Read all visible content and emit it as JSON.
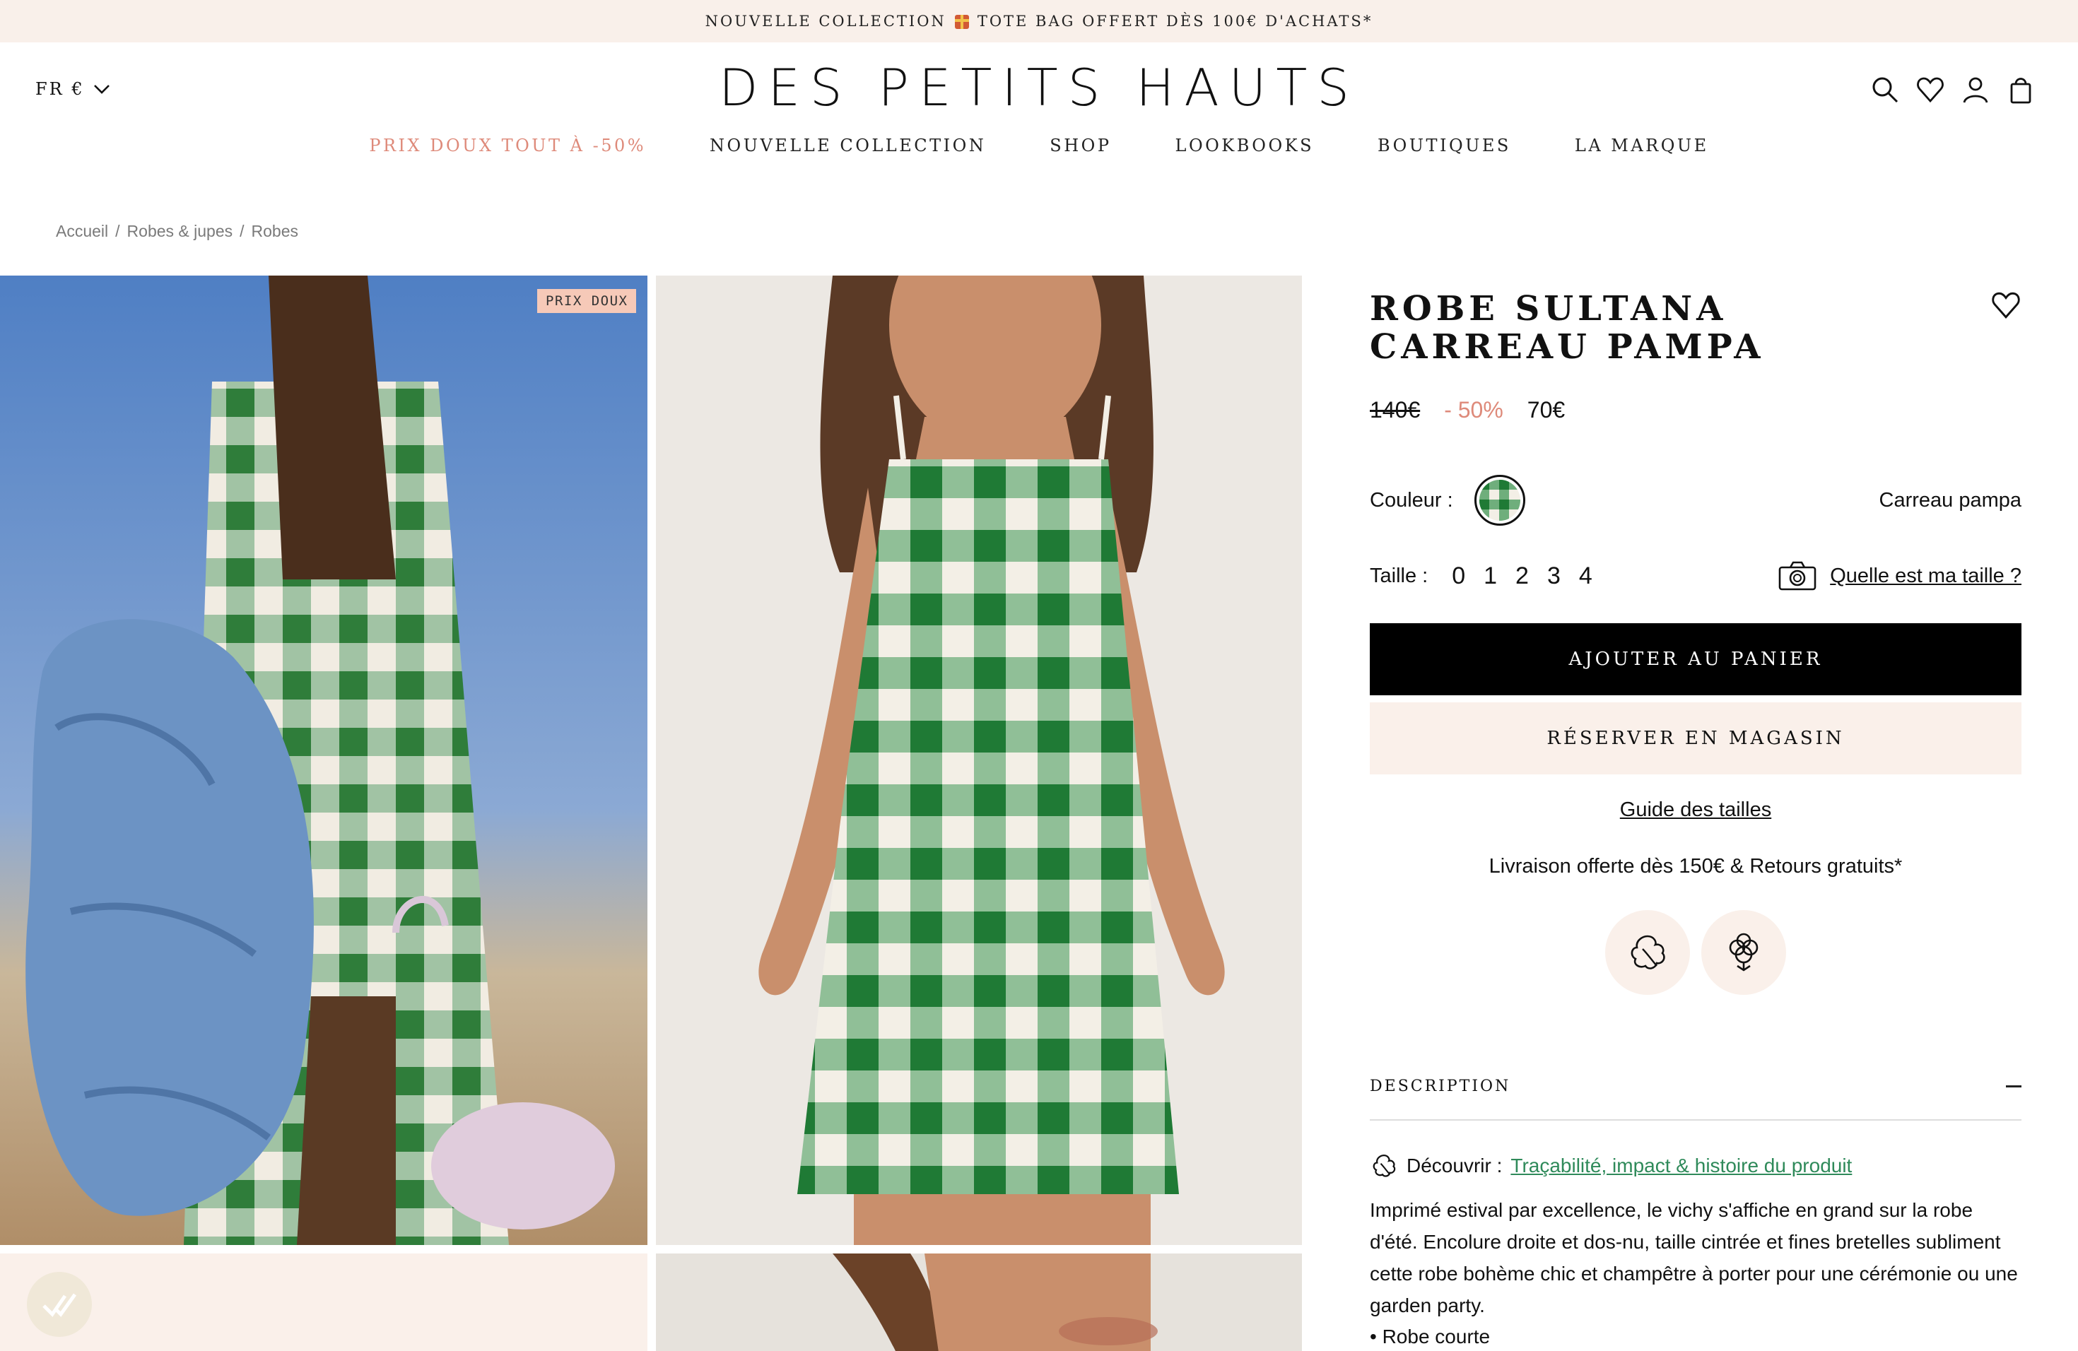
{
  "announcement": {
    "left": "NOUVELLE COLLECTION",
    "right": "TOTE BAG OFFERT DÈS 100€ D'ACHATS*"
  },
  "header": {
    "locale": "FR €",
    "logo": "DES PETITS HAUTS",
    "icons": [
      "search-icon",
      "heart-icon",
      "account-icon",
      "bag-icon"
    ]
  },
  "nav": {
    "items": [
      {
        "label": "PRIX DOUX TOUT À -50%",
        "color": "#de8a7a"
      },
      {
        "label": "NOUVELLE COLLECTION"
      },
      {
        "label": "SHOP"
      },
      {
        "label": "LOOKBOOKS"
      },
      {
        "label": "BOUTIQUES"
      },
      {
        "label": "LA MARQUE"
      }
    ]
  },
  "breadcrumb": [
    "Accueil",
    "Robes & jupes",
    "Robes"
  ],
  "gallery": {
    "badge": "PRIX DOUX"
  },
  "product": {
    "title": "ROBE SULTANA CARREAU PAMPA",
    "old_price": "140€",
    "discount": "- 50%",
    "price": "70€",
    "color_label": "Couleur :",
    "color_name": "Carreau pampa",
    "size_label": "Taille :",
    "sizes": [
      "0",
      "1",
      "2",
      "3",
      "4"
    ],
    "size_help": "Quelle est ma taille ?",
    "add_to_cart": "AJOUTER AU PANIER",
    "reserve": "RÉSERVER EN MAGASIN",
    "size_guide": "Guide des tailles",
    "shipping": "Livraison offerte dès 150€ & Retours gratuits*",
    "eco_icons": [
      "leaf-icon",
      "cotton-icon"
    ],
    "description_title": "DESCRIPTION",
    "discover_label": "Découvrir :",
    "discover_link": "Traçabilité, impact & histoire du produit",
    "description": "Imprimé estival par excellence, le vichy s'affiche en grand sur la robe d'été. Encolure droite et dos-nu, taille cintrée et fines bretelles subliment cette robe bohème chic et champêtre à porter pour une cérémonie ou une garden party.",
    "bullet": "• Robe courte"
  },
  "colors": {
    "accent": "#de8a7a",
    "cream": "#faf0ea",
    "link_green": "#2f8a5a",
    "gingham_green": "#2e8b3e"
  }
}
